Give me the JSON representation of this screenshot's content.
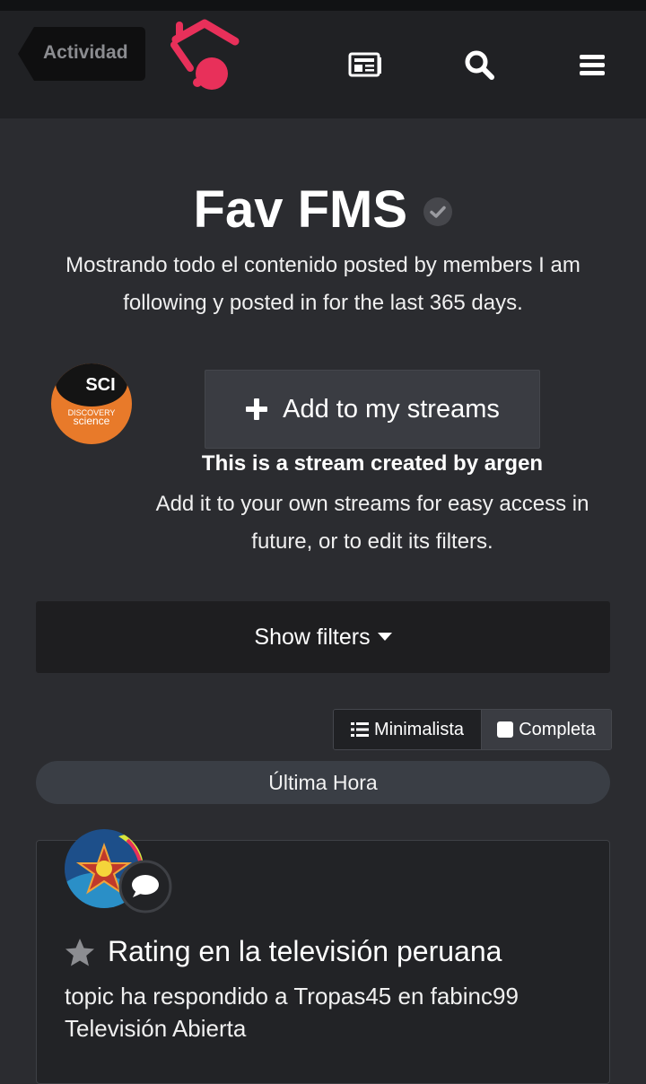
{
  "header": {
    "back_label": "Actividad",
    "icons": [
      "news-icon",
      "search-icon",
      "menu-icon"
    ],
    "brand_color": "#e8305a"
  },
  "stream": {
    "title": "Fav FMS",
    "description": "Mostrando todo el contenido posted by members I am following y posted in for the last 365 days.",
    "add_button_label": "Add to my streams",
    "created_by": "This is a stream created by argen",
    "help_text": "Add it to your own streams for easy access in future, or to edit its filters."
  },
  "filters": {
    "toggle_label": "Show filters"
  },
  "view_modes": {
    "compact_label": "Minimalista",
    "full_label": "Completa"
  },
  "section": {
    "label": "Última Hora"
  },
  "items": [
    {
      "title": "Rating en la televisión peruana",
      "meta": "topic ha respondido a Tropas45 en fabinc99 Televisión Abierta"
    }
  ]
}
